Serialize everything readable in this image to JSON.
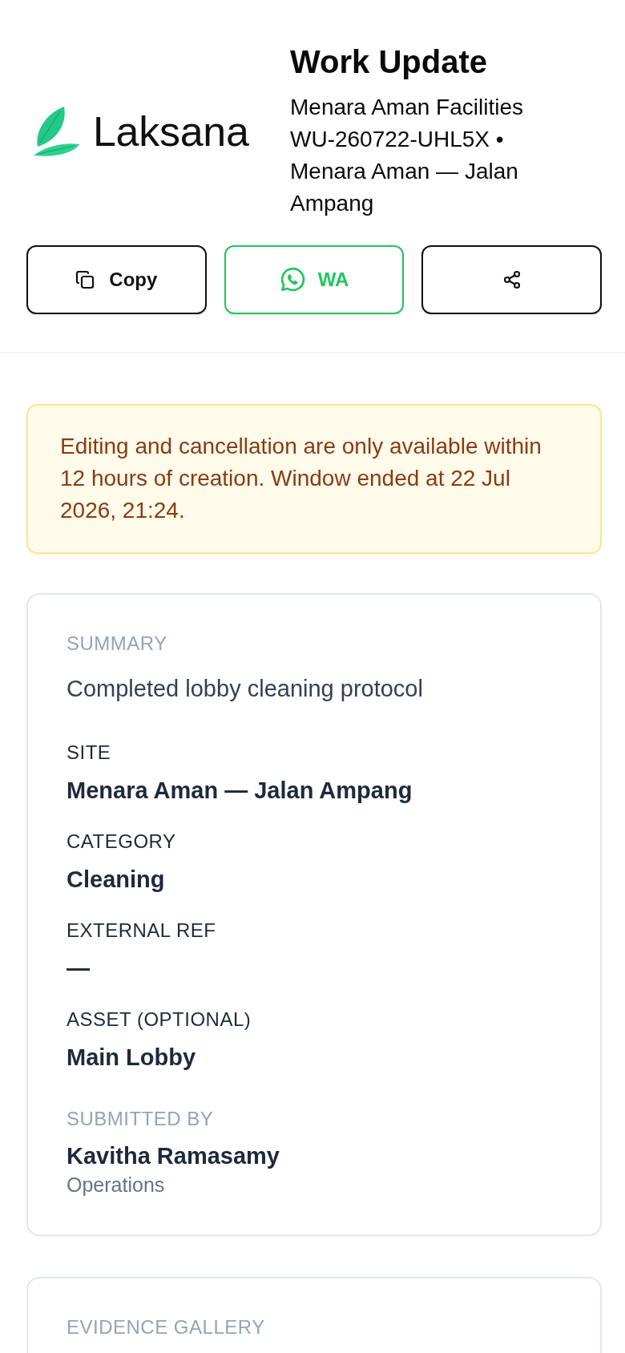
{
  "header": {
    "logo": {
      "wordmark": "Laksana"
    },
    "title": "Work Update",
    "organization": "Menara Aman Facilities",
    "reference": "WU-260722-UHL5X • Menara Aman — Jalan Ampang"
  },
  "actions": [
    {
      "kind": "copy",
      "label": "Copy"
    },
    {
      "kind": "whatsapp",
      "label": "WA"
    },
    {
      "kind": "share"
    }
  ],
  "notice": {
    "text": "Editing and cancellation are only available within 12 hours of creation. Window ended at 22 Jul 2026, 21:24."
  },
  "details": {
    "summary": {
      "label": "SUMMARY",
      "value": "Completed lobby cleaning protocol"
    },
    "fields": [
      {
        "label": "SITE",
        "value": "Menara Aman — Jalan Ampang"
      },
      {
        "label": "CATEGORY",
        "value": "Cleaning"
      },
      {
        "label": "EXTERNAL REF",
        "value": "—"
      },
      {
        "label": "ASSET (OPTIONAL)",
        "value": "Main Lobby"
      }
    ],
    "submitted_by": {
      "label": "SUBMITTED BY",
      "name": "Kavitha Ramasamy",
      "department": "Operations"
    }
  },
  "evidence_gallery": {
    "title": "EVIDENCE GALLERY"
  }
}
